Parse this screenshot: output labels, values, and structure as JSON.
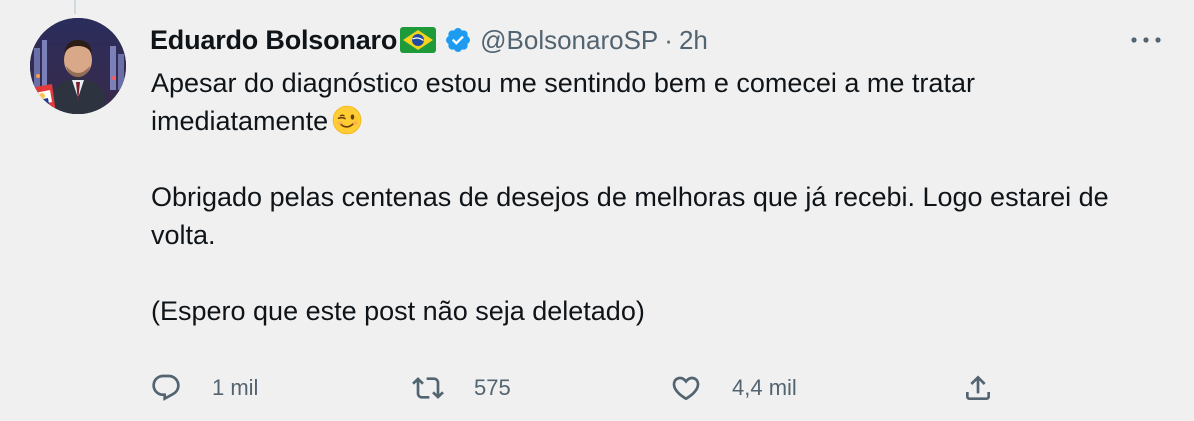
{
  "tweet": {
    "author": {
      "display_name": "Eduardo Bolsonaro",
      "handle": "@BolsonaroSP",
      "separator": "·",
      "time": "2h",
      "flag_icon": "brazil-flag-icon",
      "verified_icon": "verified-badge-icon"
    },
    "text": {
      "line1": "Apesar do diagnóstico estou me sentindo bem e comecei a me tratar imediatamente",
      "emoji": "winking-face-emoji",
      "paragraph2": "Obrigado pelas centenas de desejos de melhoras que já recebi. Logo estarei de volta.",
      "paragraph3": "(Espero que este post não seja deletado)"
    },
    "actions": {
      "reply_count": "1 mil",
      "retweet_count": "575",
      "like_count": "4,4 mil",
      "share_icon": "share-icon"
    }
  },
  "colors": {
    "background": "#f0f0f0",
    "text_primary": "#0f1419",
    "text_secondary": "#536471",
    "verified": "#1d9bf0"
  }
}
